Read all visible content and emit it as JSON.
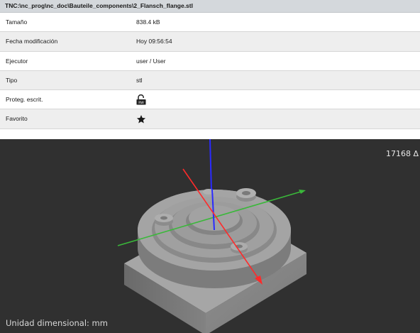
{
  "title": "TNC:\\nc_prog\\nc_doc\\Bauteile_components\\2_Flansch_flange.stl",
  "properties": [
    {
      "label": "Tamaño",
      "value": "838.4 kB"
    },
    {
      "label": "Fecha modificación",
      "value": "Hoy 09:56:54"
    },
    {
      "label": "Ejecutor",
      "value": "user / User"
    },
    {
      "label": "Tipo",
      "value": "stl"
    },
    {
      "label": "Proteg. escrit.",
      "icon": "unlocked-padlock-icon",
      "icon_text": "RW"
    },
    {
      "label": "Favorito",
      "icon": "star-icon"
    }
  ],
  "viewer": {
    "triangle_count": "17168 Δ",
    "unit_label": "Unidad dimensional: mm",
    "axis_colors": {
      "x": "#ff2a2a",
      "y": "#3ab83a",
      "z": "#2a2aff"
    },
    "background": "#303030",
    "model_color": "#9e9e9e"
  }
}
